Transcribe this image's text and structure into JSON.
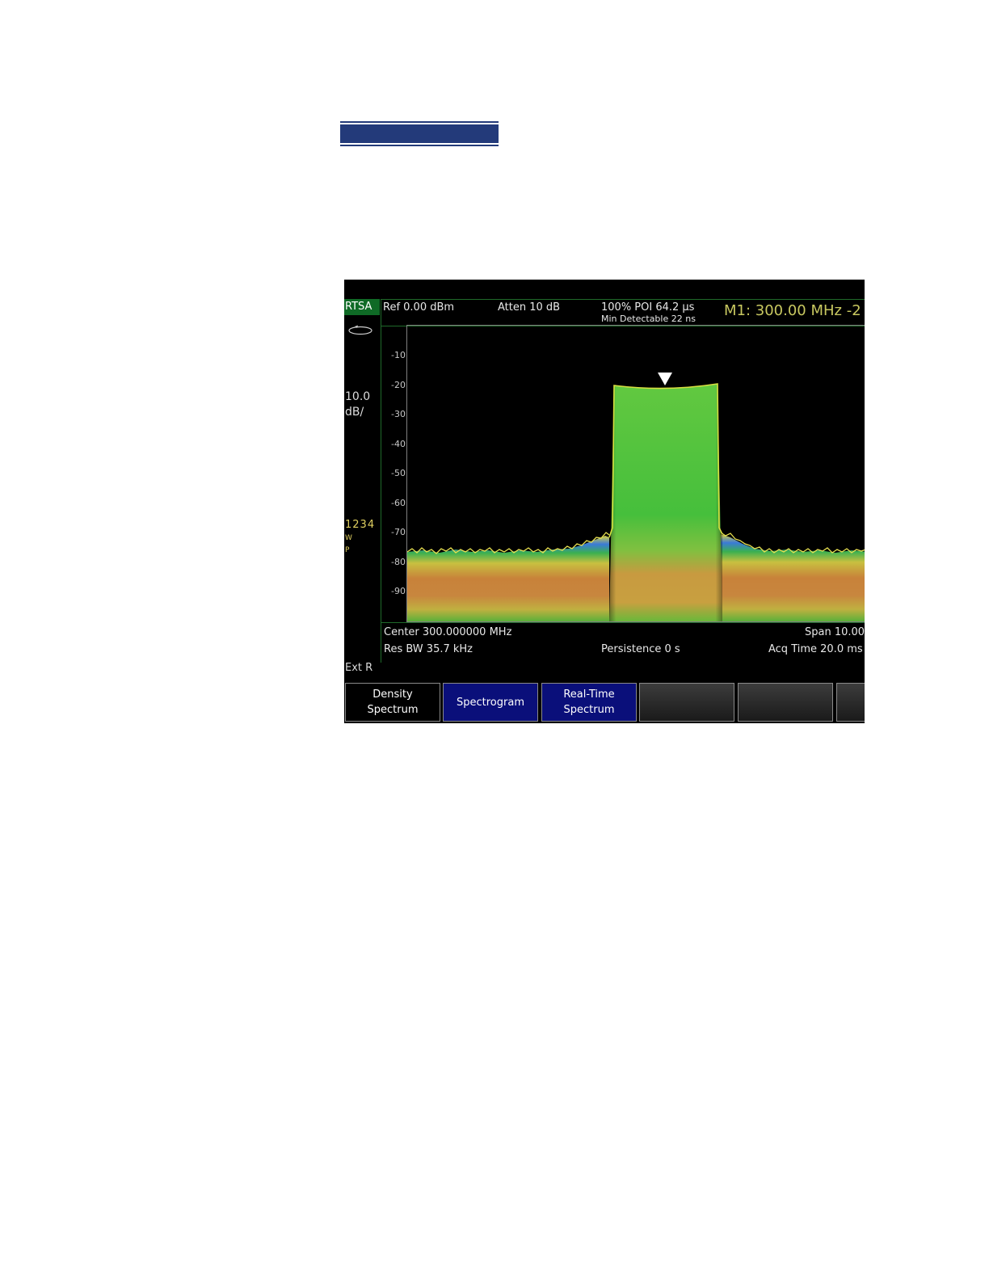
{
  "instrument": {
    "mode": "RTSA",
    "scale": {
      "value": "10.0",
      "unit": "dB/"
    },
    "traces": {
      "numbers": "1234",
      "type": "W",
      "detector": "P"
    },
    "ext_ref": "Ext R"
  },
  "top_bar": {
    "ref_level": "Ref 0.00 dBm",
    "attenuation": "Atten 10 dB",
    "poi": "100% POI 64.2 μs",
    "min_detectable": "Min Detectable 22 ns",
    "marker_readout": "M1:  300.00  MHz  -2"
  },
  "y_ticks": [
    "-10",
    "-20",
    "-30",
    "-40",
    "-50",
    "-60",
    "-70",
    "-80",
    "-90"
  ],
  "bottom_bar": {
    "center": "Center 300.000000 MHz",
    "span": "Span 10.00",
    "res_bw": "Res BW 35.7 kHz",
    "persistence": "Persistence 0  s",
    "acq_time": "Acq Time 20.0 ms"
  },
  "softkeys": [
    {
      "line1": "Density",
      "line2": "Spectrum",
      "style": "black"
    },
    {
      "line1": "Spectrogram",
      "line2": "",
      "style": "blue"
    },
    {
      "line1": "Real-Time",
      "line2": "Spectrum",
      "style": "blue"
    },
    {
      "line1": "",
      "line2": "",
      "style": "gray"
    },
    {
      "line1": "",
      "line2": "",
      "style": "gray"
    },
    {
      "line1": "",
      "line2": "",
      "style": "gray"
    }
  ],
  "colors": {
    "header_blue": "#233a7a",
    "signal_green": "#4cc13a",
    "noise_orange": "#c8823a",
    "softkey_blue": "#0a0f7a"
  }
}
